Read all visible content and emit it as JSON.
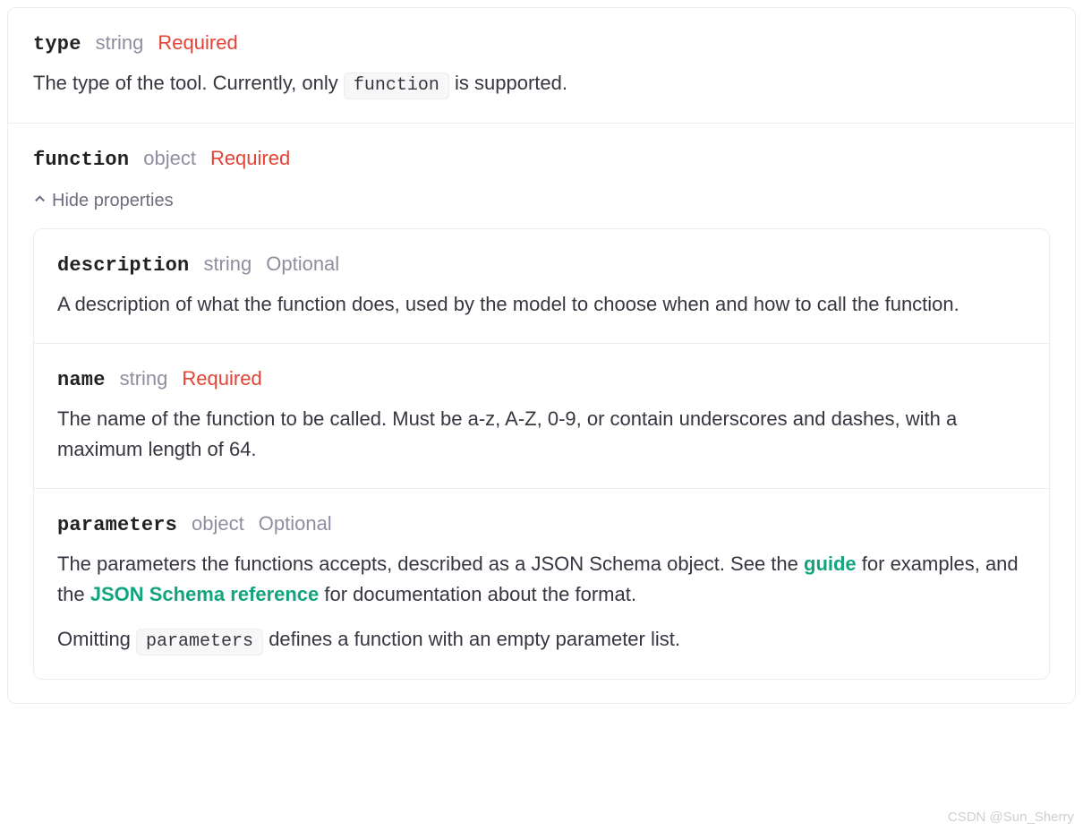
{
  "params": {
    "type": {
      "name": "type",
      "type": "string",
      "badge": "Required",
      "desc_pre": "The type of the tool. Currently, only ",
      "desc_code": "function",
      "desc_post": " is supported."
    },
    "function": {
      "name": "function",
      "type": "object",
      "badge": "Required",
      "toggle_label": "Hide properties",
      "props": {
        "description": {
          "name": "description",
          "type": "string",
          "badge": "Optional",
          "desc": "A description of what the function does, used by the model to choose when and how to call the function."
        },
        "name": {
          "name": "name",
          "type": "string",
          "badge": "Required",
          "desc": "The name of the function to be called. Must be a-z, A-Z, 0-9, or contain underscores and dashes, with a maximum length of 64."
        },
        "parameters": {
          "name": "parameters",
          "type": "object",
          "badge": "Optional",
          "desc_a": "The parameters the functions accepts, described as a JSON Schema object. See the ",
          "link1": "guide",
          "desc_b": " for examples, and the ",
          "link2": "JSON Schema reference",
          "desc_c": " for documentation about the format.",
          "desc2_a": "Omitting ",
          "desc2_code": "parameters",
          "desc2_b": " defines a function with an empty parameter list."
        }
      }
    }
  },
  "watermark": "CSDN @Sun_Sherry"
}
